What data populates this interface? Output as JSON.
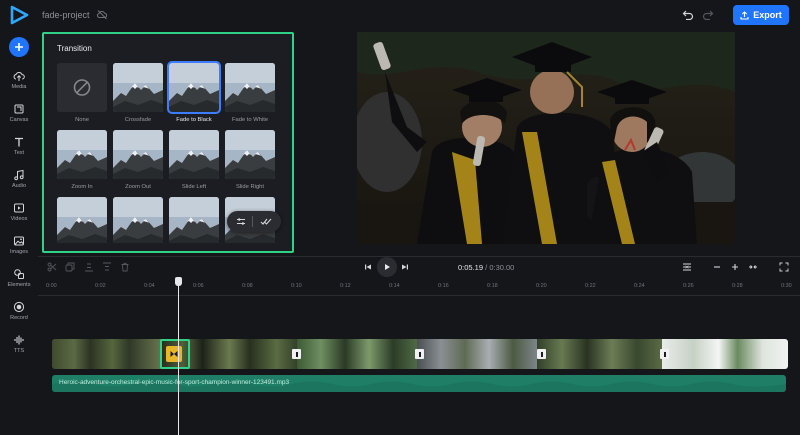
{
  "header": {
    "project_name": "fade-project",
    "export_label": "Export",
    "accent": "#1f75fe"
  },
  "sidebar": {
    "items": [
      {
        "label": "Media",
        "icon": "upload-cloud-icon"
      },
      {
        "label": "Canvas",
        "icon": "crop-icon"
      },
      {
        "label": "Text",
        "icon": "text-icon"
      },
      {
        "label": "Audio",
        "icon": "music-note-icon"
      },
      {
        "label": "Videos",
        "icon": "video-icon"
      },
      {
        "label": "Images",
        "icon": "image-icon"
      },
      {
        "label": "Elements",
        "icon": "shapes-icon"
      },
      {
        "label": "Record",
        "icon": "record-icon"
      },
      {
        "label": "TTS",
        "icon": "audio-wave-icon"
      }
    ]
  },
  "transition_panel": {
    "title": "Transition",
    "selected": "Fade to Black",
    "items": [
      {
        "label": "None"
      },
      {
        "label": "Crossfade"
      },
      {
        "label": "Fade to Black"
      },
      {
        "label": "Fade to White"
      },
      {
        "label": "Zoom In"
      },
      {
        "label": "Zoom Out"
      },
      {
        "label": "Slide Left"
      },
      {
        "label": "Slide Right"
      },
      {
        "label": ""
      },
      {
        "label": ""
      },
      {
        "label": ""
      },
      {
        "label": ""
      }
    ],
    "highlight_color": "#2fd287"
  },
  "player": {
    "current_time": "0:05.19",
    "total_time": "0:30.00"
  },
  "timeline": {
    "ruler_ticks": [
      "0:00",
      "0:02",
      "0:04",
      "0:06",
      "0:08",
      "0:10",
      "0:12",
      "0:14",
      "0:16",
      "0:18",
      "0:20",
      "0:22",
      "0:24",
      "0:26",
      "0:28",
      "0:30"
    ],
    "audio_track_label": "Heroic-adventure-orchestral-epic-music-for-sport-champion-winner-123491.mp3",
    "audio_color": "#1f7f66"
  }
}
